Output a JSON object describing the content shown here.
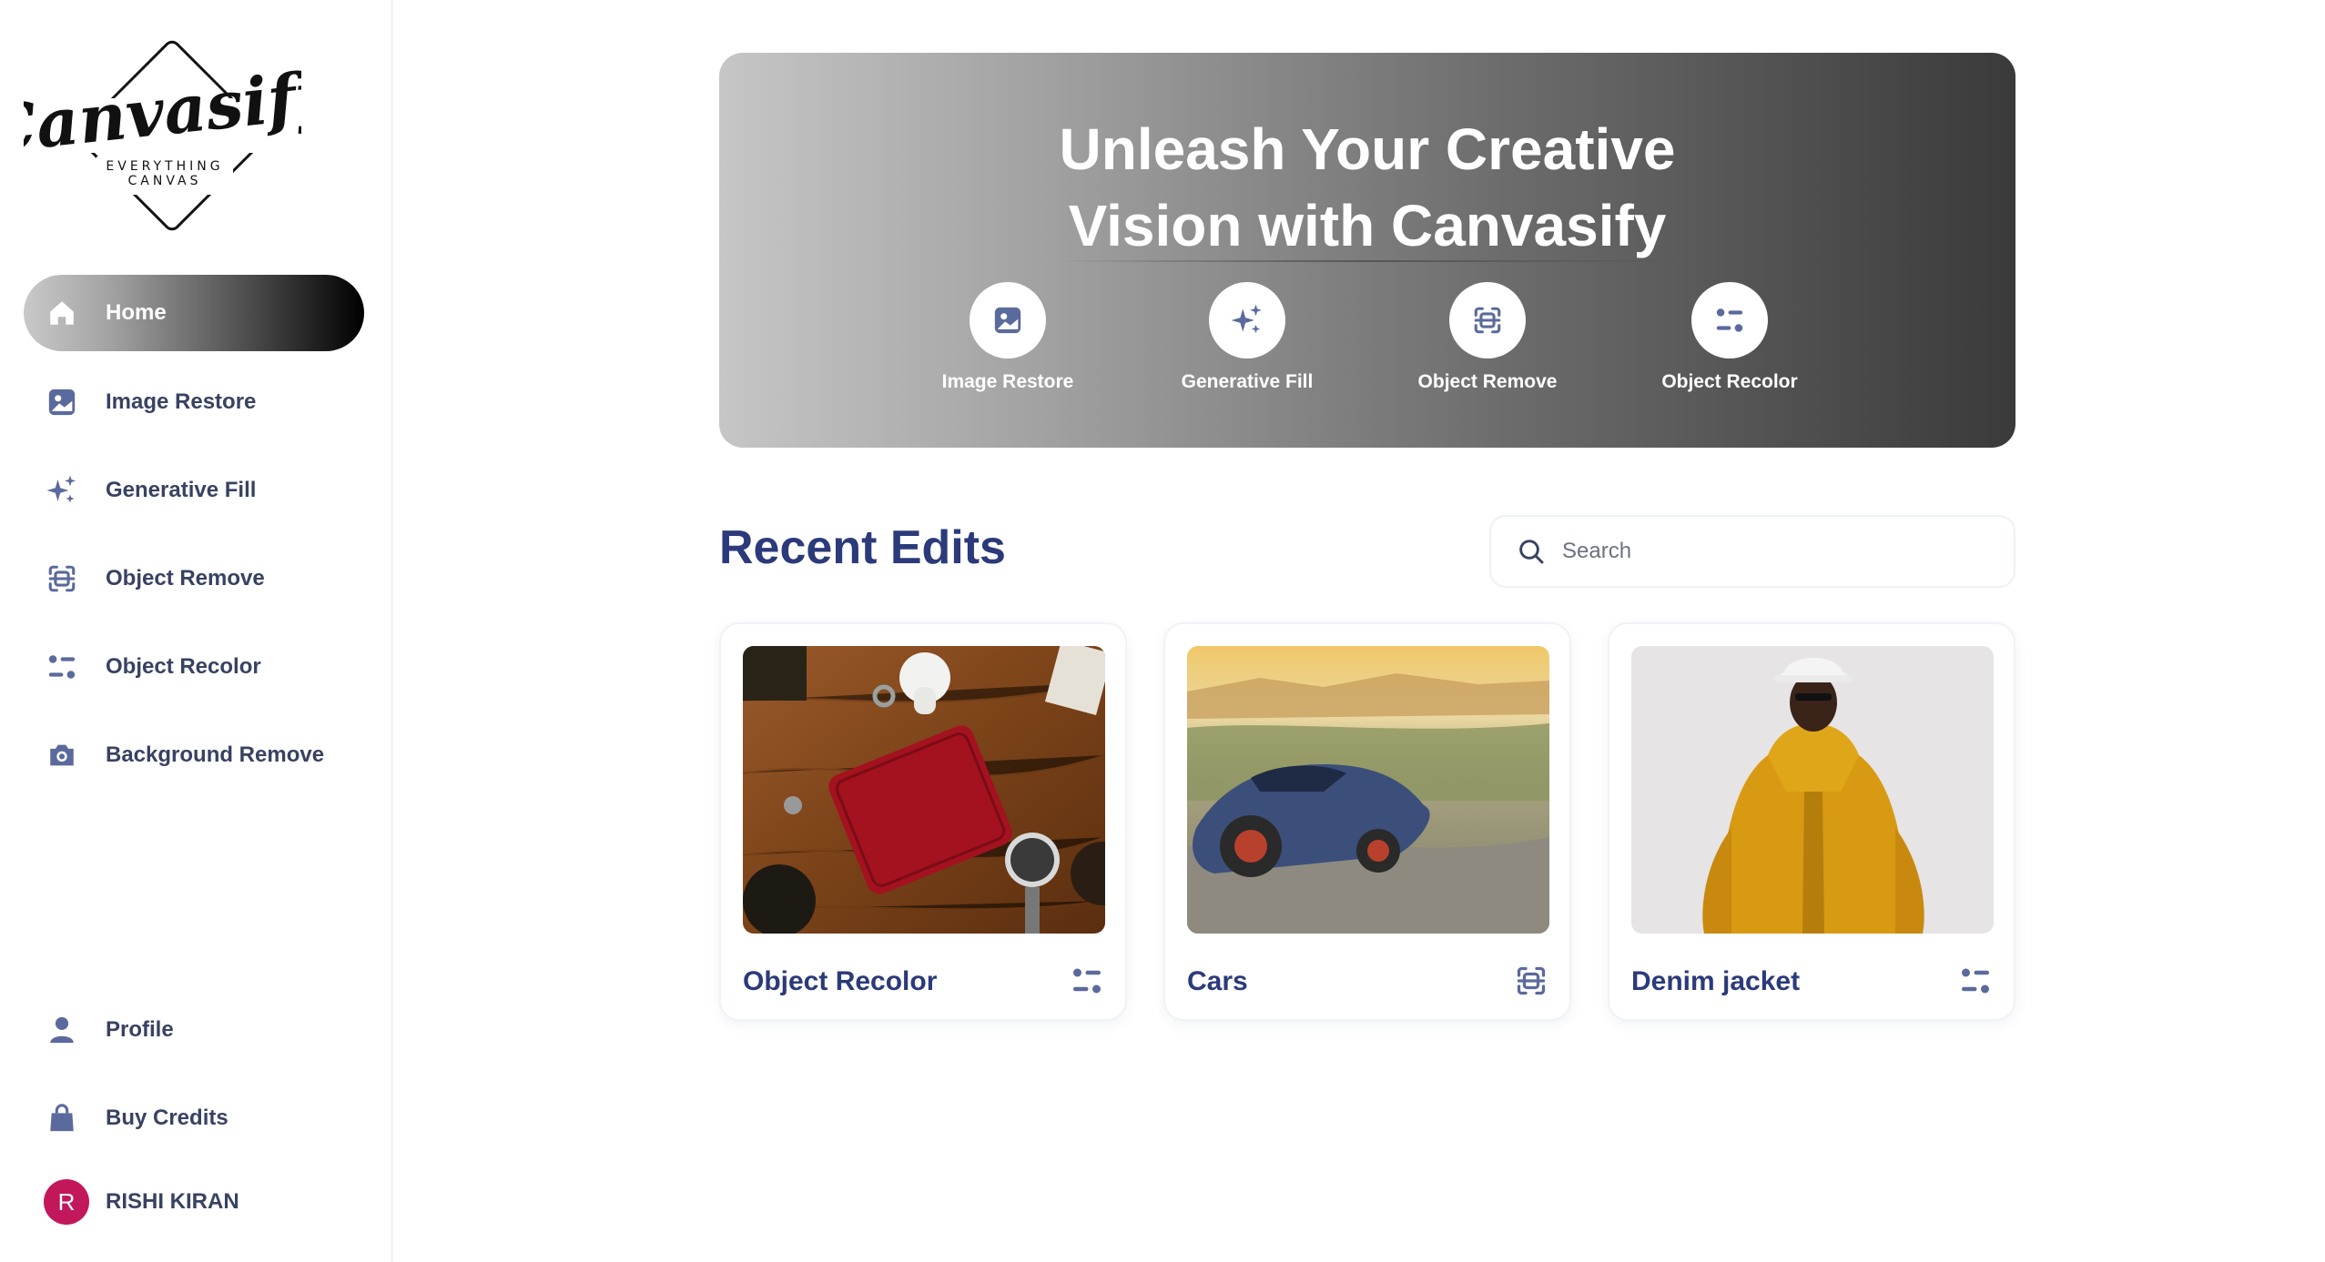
{
  "app": {
    "logo_script": "Canvasify",
    "logo_tagline_1": "EVERYTHING",
    "logo_tagline_2": "CANVAS"
  },
  "sidebar": {
    "items": [
      {
        "label": "Home",
        "icon": "home-icon",
        "active": true
      },
      {
        "label": "Image Restore",
        "icon": "image-icon"
      },
      {
        "label": "Generative Fill",
        "icon": "sparkles-icon"
      },
      {
        "label": "Object Remove",
        "icon": "scan-icon"
      },
      {
        "label": "Object Recolor",
        "icon": "filter-icon"
      },
      {
        "label": "Background Remove",
        "icon": "camera-icon"
      }
    ],
    "bottom_items": [
      {
        "label": "Profile",
        "icon": "user-icon"
      },
      {
        "label": "Buy Credits",
        "icon": "bag-icon"
      }
    ],
    "user": {
      "initial": "R",
      "name": "RISHI KIRAN"
    }
  },
  "hero": {
    "title": "Unleash Your Creative\nVision with Canvasify",
    "tools": [
      {
        "label": "Image Restore",
        "icon": "image-icon"
      },
      {
        "label": "Generative Fill",
        "icon": "sparkles-icon"
      },
      {
        "label": "Object Remove",
        "icon": "scan-icon"
      },
      {
        "label": "Object Recolor",
        "icon": "filter-icon"
      }
    ]
  },
  "recent": {
    "title": "Recent Edits",
    "search_placeholder": "Search",
    "search_value": "",
    "cards": [
      {
        "title": "Object Recolor",
        "icon": "filter-icon"
      },
      {
        "title": "Cars",
        "icon": "scan-icon"
      },
      {
        "title": "Denim jacket",
        "icon": "filter-icon"
      }
    ]
  },
  "colors": {
    "accent_text": "#2b3a7a",
    "icon": "#5b6a9c",
    "avatar": "#c2185b"
  }
}
